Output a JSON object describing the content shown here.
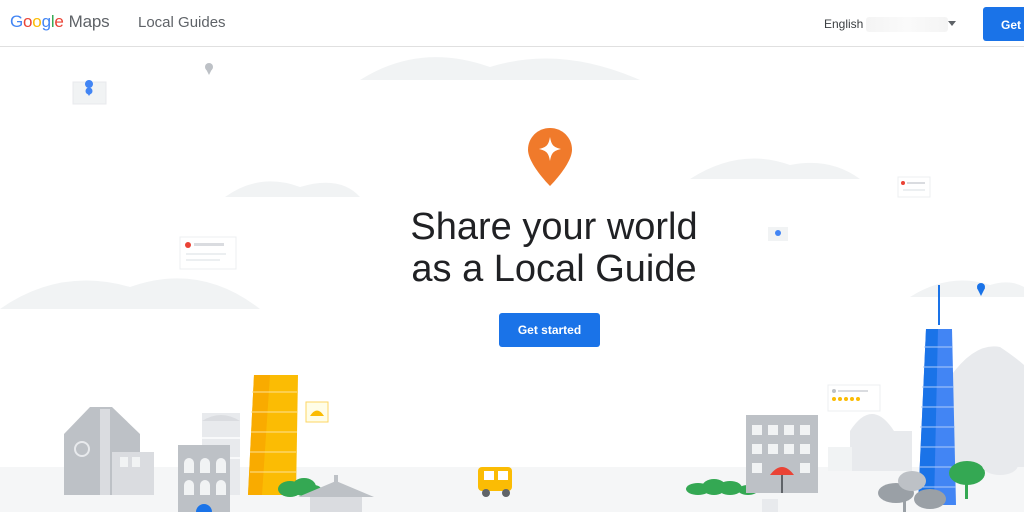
{
  "header": {
    "brand_letters": [
      "G",
      "o",
      "o",
      "g",
      "l",
      "e"
    ],
    "brand_product": "Maps",
    "nav_local_guides": "Local Guides",
    "language_selected": "English",
    "get_started_label": "Get"
  },
  "hero": {
    "title_line1": "Share your world",
    "title_line2": "as a Local Guide",
    "cta_label": "Get started"
  },
  "colors": {
    "primary_blue": "#1a73e8",
    "local_guides_orange": "#f07a2b",
    "text_dark": "#202124",
    "text_gray": "#5f6368"
  },
  "icons": [
    "local-guides-star-pin-icon",
    "map-pin-icon",
    "chevron-down-icon"
  ]
}
